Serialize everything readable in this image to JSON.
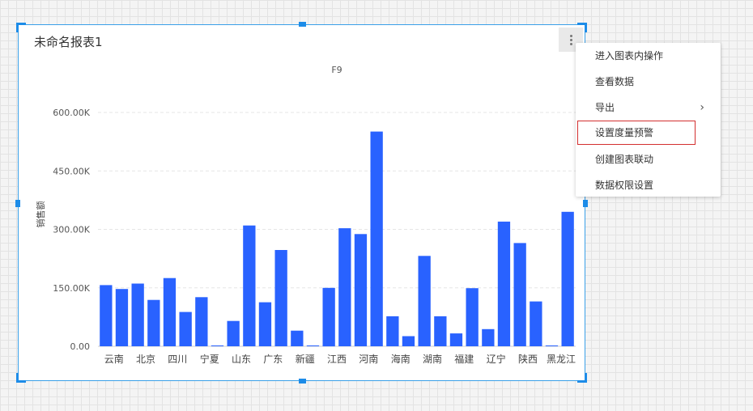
{
  "widget": {
    "title": "未命名报表1"
  },
  "chart_data": {
    "type": "bar",
    "title": "F9",
    "ylabel": "销售额",
    "xlabel": "",
    "ylim": [
      0,
      600000
    ],
    "y_ticks": [
      {
        "value": 0,
        "label": "0.00"
      },
      {
        "value": 150000,
        "label": "150.00K"
      },
      {
        "value": 300000,
        "label": "300.00K"
      },
      {
        "value": 450000,
        "label": "450.00K"
      },
      {
        "value": 600000,
        "label": "600.00K"
      }
    ],
    "bar_color": "#2962ff",
    "grid": true,
    "x_tick_labels": [
      "云南",
      "北京",
      "四川",
      "宁夏",
      "山东",
      "广东",
      "新疆",
      "江西",
      "河南",
      "海南",
      "湖南",
      "福建",
      "辽宁",
      "陕西",
      "黑龙江"
    ],
    "values": [
      157000,
      147000,
      161000,
      119000,
      175000,
      88000,
      126000,
      2000,
      65000,
      310000,
      113000,
      247000,
      40000,
      2000,
      150000,
      303000,
      288000,
      551000,
      77000,
      26000,
      232000,
      77000,
      33000,
      149000,
      44000,
      320000,
      265000,
      115000,
      2000,
      345000
    ]
  },
  "menu": {
    "items": [
      {
        "label": "进入图表内操作",
        "has_submenu": false,
        "highlighted": false
      },
      {
        "label": "查看数据",
        "has_submenu": false,
        "highlighted": false
      },
      {
        "label": "导出",
        "has_submenu": true,
        "highlighted": false
      },
      {
        "label": "设置度量预警",
        "has_submenu": false,
        "highlighted": true
      },
      {
        "label": "创建图表联动",
        "has_submenu": false,
        "highlighted": false
      },
      {
        "label": "数据权限设置",
        "has_submenu": false,
        "highlighted": false
      }
    ]
  }
}
